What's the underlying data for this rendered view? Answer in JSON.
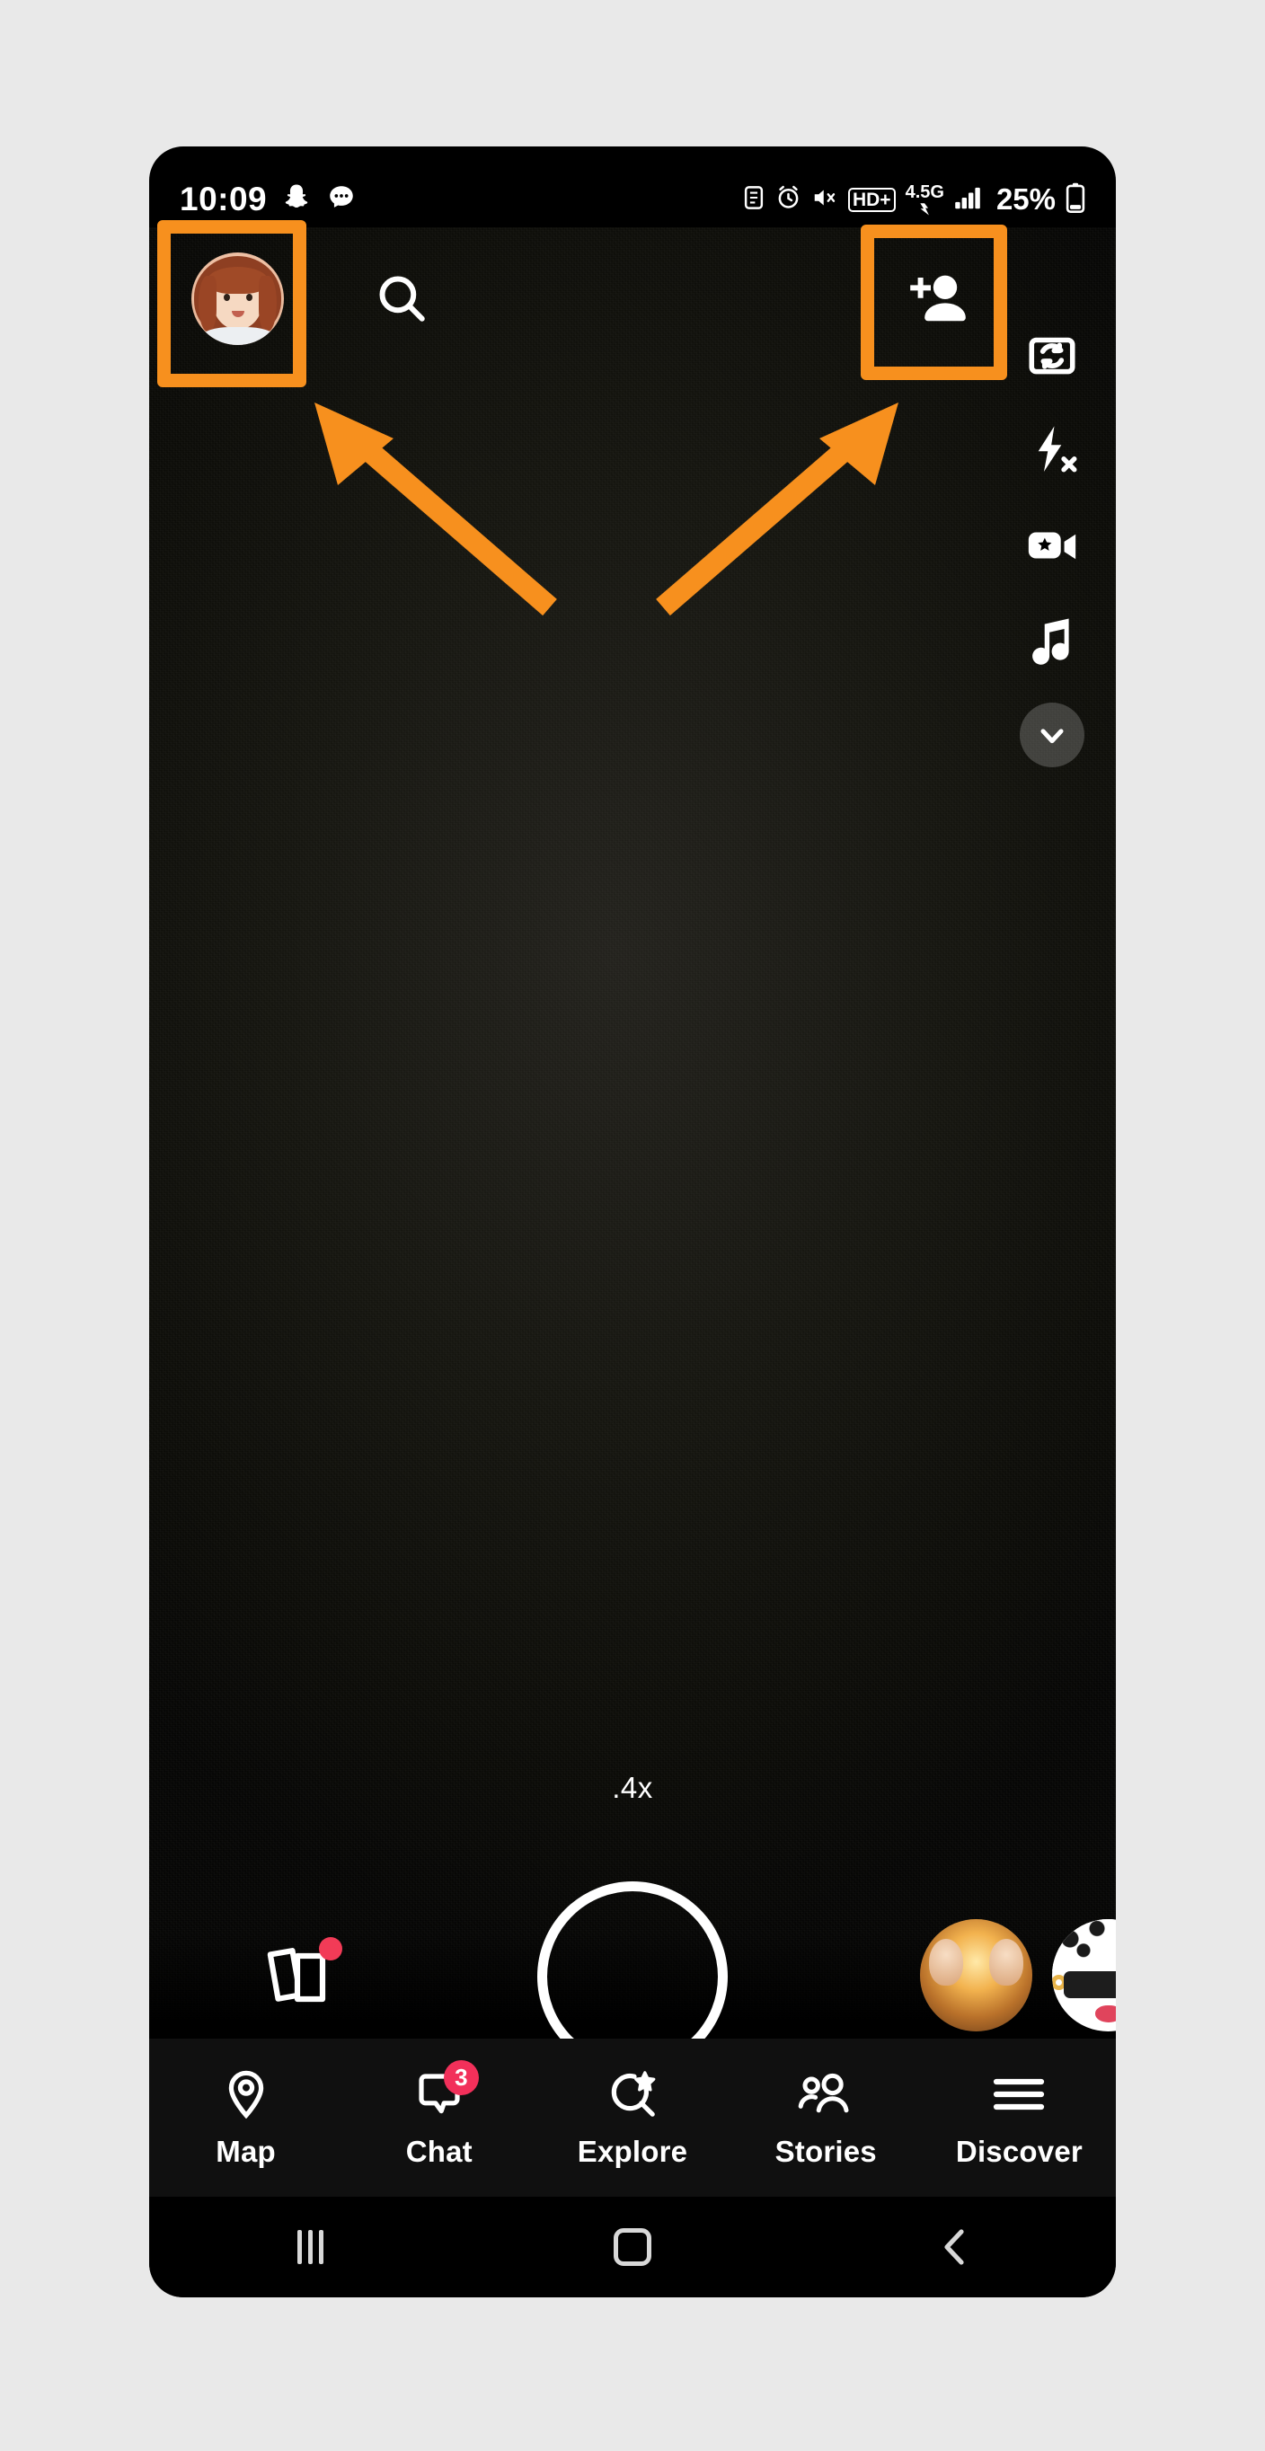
{
  "page": {
    "background_color": "#e9e9e9",
    "annotation_color": "#f7901e",
    "app": "Snapchat",
    "screen": "camera"
  },
  "status_bar": {
    "time": "10:09",
    "left_icons": [
      "snapchat-ghost-icon",
      "chat-bubble-icon"
    ],
    "right_icons": [
      "clipboard-icon",
      "alarm-icon",
      "mute-icon",
      "hd-plus-icon",
      "network-4-5g-icon",
      "signal-bars-icon"
    ],
    "network_hd": "HD+",
    "network_gen": "4.5G",
    "battery_percent": "25%"
  },
  "top_bar": {
    "avatar": {
      "name": "bitmoji-avatar",
      "alt": "profile bitmoji"
    },
    "search_icon": "search-icon",
    "add_friend_icon": "add-friend-icon"
  },
  "tool_rail": {
    "items": [
      {
        "icon": "flip-camera-icon",
        "label": "Flip camera"
      },
      {
        "icon": "flash-off-icon",
        "label": "Flash off"
      },
      {
        "icon": "spotlight-video-icon",
        "label": "Video"
      },
      {
        "icon": "music-note-icon",
        "label": "Music"
      },
      {
        "icon": "chevron-down-icon",
        "label": "More"
      }
    ]
  },
  "camera": {
    "zoom_level": ".4x",
    "memories_icon": "memories-icon",
    "memories_has_unread": true,
    "shutter": "shutter-button",
    "lens_carousel": [
      {
        "name": "lens-thumbnail-1"
      },
      {
        "name": "lens-thumbnail-2"
      },
      {
        "name": "lens-thumbnail-3"
      }
    ]
  },
  "nav_bar": {
    "items": [
      {
        "label": "Map",
        "icon": "map-pin-icon",
        "badge": null
      },
      {
        "label": "Chat",
        "icon": "chat-bubble-icon",
        "badge": "3"
      },
      {
        "label": "Explore",
        "icon": "explore-star-icon",
        "badge": null
      },
      {
        "label": "Stories",
        "icon": "stories-people-icon",
        "badge": null
      },
      {
        "label": "Discover",
        "icon": "hamburger-icon",
        "badge": null
      }
    ],
    "badge_color": "#f2305a"
  },
  "system_nav": {
    "recents_icon": "recents-icon",
    "home_icon": "home-icon",
    "back_icon": "back-icon"
  },
  "annotations": {
    "highlight_boxes": [
      {
        "name": "highlight-avatar",
        "target": "bitmoji-avatar"
      },
      {
        "name": "highlight-add-friend",
        "target": "add-friend-icon"
      }
    ],
    "arrows": [
      {
        "name": "arrow-to-avatar",
        "points_to": "bitmoji-avatar"
      },
      {
        "name": "arrow-to-add-friend",
        "points_to": "add-friend-icon"
      }
    ]
  }
}
